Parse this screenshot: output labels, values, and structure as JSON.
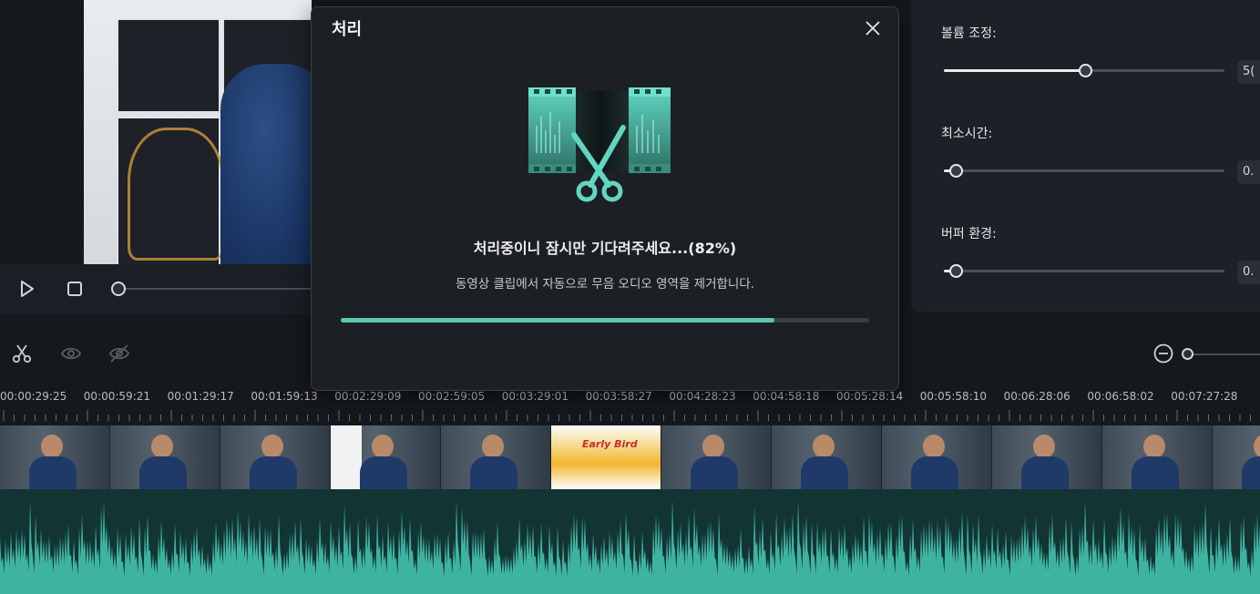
{
  "colors": {
    "accent": "#5ac8b4",
    "dialog_bg": "#1c1f24",
    "panel_bg": "#1d2127"
  },
  "dialog": {
    "title": "처리",
    "status": "처리중이니 잠시만 기다려주세요...(82%)",
    "description": "동영상 클립에서 자동으로 무음 오디오 영역을 제거합니다.",
    "progress": 0.82,
    "close_icon": "close-icon",
    "illustration_icon": "film-cut-scissors-icon"
  },
  "player": {
    "play_icon": "play-icon",
    "stop_icon": "stop-icon"
  },
  "properties": {
    "volume": {
      "label": "볼륨 조정:",
      "value": "5(",
      "level": 0.5
    },
    "min_time": {
      "label": "최소시간:",
      "value": "0.",
      "level": 0.04
    },
    "buffer": {
      "label": "버퍼 환경:",
      "value": "0.",
      "level": 0.04
    }
  },
  "toolbar": {
    "icons": [
      "scissors-icon",
      "eye-icon",
      "eye-off-icon",
      "zoom-out-icon"
    ]
  },
  "ruler": {
    "labels": [
      "00:00:29:25",
      "00:00:59:21",
      "00:01:29:17",
      "00:01:59:13",
      "00:02:29:09",
      "00:02:59:05",
      "00:03:29:01",
      "00:03:58:27",
      "00:04:28:23",
      "00:04:58:18",
      "00:05:28:14",
      "00:05:58:10",
      "00:06:28:06",
      "00:06:58:02",
      "00:07:27:28"
    ]
  },
  "clips": {
    "caption": "Early Bird"
  }
}
